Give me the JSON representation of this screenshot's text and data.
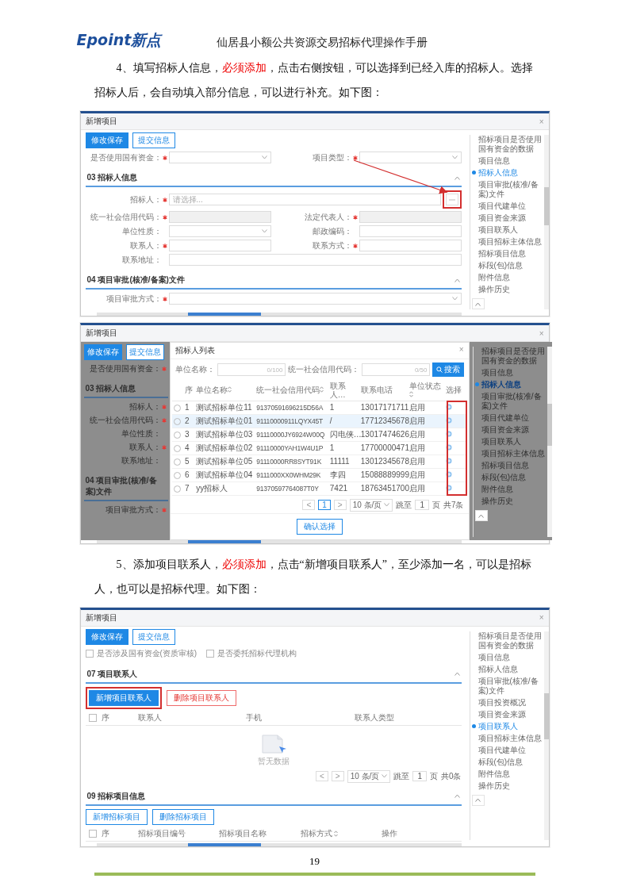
{
  "header": {
    "logo": "Epoint新点",
    "title": "仙居县小额公共资源交易招标代理操作手册"
  },
  "blocks": [
    {
      "kind": "paragraph",
      "segments": [
        {
          "text": "4、填写招标人信息，",
          "emphasis": false
        },
        {
          "text": "必须添加",
          "emphasis": true
        },
        {
          "text": "，点击右侧按钮，可以选择到已经入库的招标人。选择招标人后，会自动填入部分信息，可以进行补充。如下图：",
          "emphasis": false
        }
      ]
    },
    {
      "kind": "screen",
      "window_title": "新增项目",
      "close": "×",
      "masked": false,
      "toolbar": [
        {
          "label": "修改保存",
          "primary": true
        },
        {
          "label": "提交信息",
          "primary": false
        }
      ],
      "main": [
        {
          "kind": "fields",
          "fields": [
            {
              "label": "是否使用国有资金：",
              "required": true,
              "kind": "select"
            },
            {
              "label": "项目类型：",
              "required": true,
              "kind": "select"
            }
          ]
        },
        {
          "kind": "section",
          "title": "03 招标人信息"
        },
        {
          "kind": "fields",
          "fields": [
            {
              "label": "招标人：",
              "required": true,
              "kind": "lookup",
              "placeholder": "请选择...",
              "annotated": true
            }
          ]
        },
        {
          "kind": "fields",
          "fields": [
            {
              "label": "统一社会信用代码：",
              "required": true,
              "kind": "readonly"
            },
            {
              "label": "法定代表人：",
              "required": true,
              "kind": "readonly"
            }
          ]
        },
        {
          "kind": "fields",
          "fields": [
            {
              "label": "单位性质：",
              "required": false,
              "kind": "select"
            },
            {
              "label": "邮政编码：",
              "required": false,
              "kind": "input"
            }
          ]
        },
        {
          "kind": "fields",
          "fields": [
            {
              "label": "联系人：",
              "required": true,
              "kind": "input"
            },
            {
              "label": "联系方式：",
              "required": true,
              "kind": "input"
            }
          ]
        },
        {
          "kind": "fields",
          "fields": [
            {
              "label": "联系地址：",
              "required": false,
              "kind": "input"
            }
          ]
        },
        {
          "kind": "section",
          "title": "04 项目审批(核准/备案)文件"
        },
        {
          "kind": "fields",
          "fields": [
            {
              "label": "项目审批方式：",
              "required": true,
              "kind": "select"
            }
          ]
        }
      ],
      "nav": [
        {
          "label": "招标项目是否使用国有资金的数据",
          "selected": false
        },
        {
          "label": "项目信息",
          "selected": false
        },
        {
          "label": "招标人信息",
          "selected": true
        },
        {
          "label": "项目审批(核准/备案)文件",
          "selected": false
        },
        {
          "label": "项目代建单位",
          "selected": false
        },
        {
          "label": "项目资金来源",
          "selected": false
        },
        {
          "label": "项目联系人",
          "selected": false
        },
        {
          "label": "项目招标主体信息",
          "selected": false
        },
        {
          "label": "招标项目信息",
          "selected": false
        },
        {
          "label": "标段(包)信息",
          "selected": false
        },
        {
          "label": "附件信息",
          "selected": false
        },
        {
          "label": "操作历史",
          "selected": false
        }
      ]
    },
    {
      "kind": "screen",
      "window_title": "新增项目",
      "close": "×",
      "masked": true,
      "toolbar": [
        {
          "label": "修改保存",
          "primary": true
        },
        {
          "label": "提交信息",
          "primary": false
        }
      ],
      "main": [
        {
          "kind": "fields",
          "fields": [
            {
              "label": "是否使用国有资金：",
              "required": true,
              "kind": "hidden"
            }
          ]
        },
        {
          "kind": "section",
          "title": "03 招标人信息"
        },
        {
          "kind": "fields",
          "fields": [
            {
              "label": "招标人：",
              "required": true,
              "kind": "hidden"
            }
          ]
        },
        {
          "kind": "fields",
          "fields": [
            {
              "label": "统一社会信用代码：",
              "required": true,
              "kind": "hidden"
            }
          ]
        },
        {
          "kind": "fields",
          "fields": [
            {
              "label": "单位性质：",
              "required": false,
              "kind": "hidden"
            }
          ]
        },
        {
          "kind": "fields",
          "fields": [
            {
              "label": "联系人：",
              "required": true,
              "kind": "hidden"
            }
          ]
        },
        {
          "kind": "fields",
          "fields": [
            {
              "label": "联系地址：",
              "required": false,
              "kind": "hidden"
            }
          ]
        },
        {
          "kind": "section",
          "title": "04 项目审批(核准/备案)文件"
        },
        {
          "kind": "fields",
          "fields": [
            {
              "label": "项目审批方式：",
              "required": true,
              "kind": "hidden"
            }
          ]
        }
      ],
      "dialog": {
        "title": "招标人列表",
        "close": "×",
        "search": [
          {
            "label": "单位名称：",
            "counter": "0/100"
          },
          {
            "label": "统一社会信用代码：",
            "counter": "0/50"
          }
        ],
        "search_button": "搜索",
        "columns": [
          {
            "label": "序",
            "sortable": false,
            "annotated": false
          },
          {
            "label": "单位名称",
            "sortable": true,
            "annotated": false
          },
          {
            "label": "统一社会信用代码",
            "sortable": true,
            "annotated": false
          },
          {
            "label": "联系人…",
            "sortable": false,
            "annotated": false
          },
          {
            "label": "联系电话",
            "sortable": false,
            "annotated": false
          },
          {
            "label": "单位状态",
            "sortable": true,
            "annotated": false
          },
          {
            "label": "选择",
            "sortable": false,
            "annotated": true
          }
        ],
        "rows": [
          {
            "selected": false,
            "cells": [
              "1",
              "测试招标单位11",
              "91370591696215D56A",
              "1",
              "13017171711",
              "启用"
            ]
          },
          {
            "selected": true,
            "cells": [
              "2",
              "测试招标单位01",
              "91110000911LQYX45T",
              "/",
              "17712345678",
              "启用"
            ]
          },
          {
            "selected": false,
            "cells": [
              "3",
              "测试招标单位03",
              "91110000JY6924W00Q",
              "闪电侠…",
              "13017474626",
              "启用"
            ]
          },
          {
            "selected": false,
            "cells": [
              "4",
              "测试招标单位02",
              "91110000YAH1W4U1P",
              "1",
              "17700000471",
              "启用"
            ]
          },
          {
            "selected": false,
            "cells": [
              "5",
              "测试招标单位05",
              "91110000RR8SYT91K",
              "11111",
              "13012345678",
              "启用"
            ]
          },
          {
            "selected": false,
            "cells": [
              "6",
              "测试招标单位04",
              "9111000XX0WHM29K",
              "李四",
              "15088889999",
              "启用"
            ]
          },
          {
            "selected": false,
            "cells": [
              "7",
              "yy招标人",
              "91370597764087T0Y",
              "7421",
              "18763451700",
              "启用"
            ]
          }
        ],
        "pagination": {
          "prev": "<",
          "pages": [
            {
              "label": "1",
              "selected": true
            }
          ],
          "next": ">",
          "size": "10 条/页",
          "jump_label": "跳至",
          "jump_value": "1",
          "page_unit": "页",
          "total": "共7条"
        },
        "confirm": "确认选择"
      },
      "nav": [
        {
          "label": "招标项目是否使用国有资金的数据",
          "selected": false
        },
        {
          "label": "项目信息",
          "selected": false
        },
        {
          "label": "招标人信息",
          "selected": true
        },
        {
          "label": "项目审批(核准/备案)文件",
          "selected": false
        },
        {
          "label": "项目代建单位",
          "selected": false
        },
        {
          "label": "项目资金来源",
          "selected": false
        },
        {
          "label": "项目联系人",
          "selected": false
        },
        {
          "label": "项目招标主体信息",
          "selected": false
        },
        {
          "label": "招标项目信息",
          "selected": false
        },
        {
          "label": "标段(包)信息",
          "selected": false
        },
        {
          "label": "附件信息",
          "selected": false
        },
        {
          "label": "操作历史",
          "selected": false
        }
      ]
    },
    {
      "kind": "paragraph",
      "segments": [
        {
          "text": "5、添加项目联系人，",
          "emphasis": false
        },
        {
          "text": "必须添加",
          "emphasis": true
        },
        {
          "text": "，点击“新增项目联系人”，至少添加一名，可以是招标人，也可以是招标代理。如下图：",
          "emphasis": false
        }
      ]
    },
    {
      "kind": "screen",
      "window_title": "新增项目",
      "close": "×",
      "masked": false,
      "toolbar": [
        {
          "label": "修改保存",
          "primary": true
        },
        {
          "label": "提交信息",
          "primary": false
        }
      ],
      "main": [
        {
          "kind": "checks",
          "items": [
            {
              "label": "是否涉及国有资金(资质审核)",
              "checked": false
            },
            {
              "label": "是否委托招标代理机构",
              "checked": false
            }
          ]
        },
        {
          "kind": "section",
          "title": "07 项目联系人"
        },
        {
          "kind": "buttons",
          "items": [
            {
              "label": "新增项目联系人",
              "kind": "primary",
              "annotated": true
            },
            {
              "label": "删除项目联系人",
              "kind": "danger",
              "annotated": false
            }
          ]
        },
        {
          "kind": "table_header",
          "checked": false,
          "columns": [
            {
              "label": "序",
              "sortable": false
            },
            {
              "label": "联系人",
              "sortable": false
            },
            {
              "label": "手机",
              "sortable": false
            },
            {
              "label": "联系人类型",
              "sortable": false
            }
          ]
        },
        {
          "kind": "empty",
          "text": "暂无数据"
        },
        {
          "kind": "pagination",
          "prev": "<",
          "next": ">",
          "size": "10 条/页",
          "jump_label": "跳至",
          "jump_value": "1",
          "page_unit": "页",
          "total": "共0条"
        },
        {
          "kind": "section",
          "title": "09 招标项目信息"
        },
        {
          "kind": "buttons",
          "items": [
            {
              "label": "新增招标项目",
              "kind": "outline",
              "annotated": false
            },
            {
              "label": "删除招标项目",
              "kind": "outline",
              "annotated": false
            }
          ]
        },
        {
          "kind": "table_header",
          "checked": false,
          "columns": [
            {
              "label": "序",
              "sortable": false
            },
            {
              "label": "招标项目编号",
              "sortable": false
            },
            {
              "label": "招标项目名称",
              "sortable": false
            },
            {
              "label": "招标方式",
              "sortable": true
            },
            {
              "label": "操作",
              "sortable": false
            }
          ]
        }
      ],
      "nav": [
        {
          "label": "招标项目是否使用国有资金的数据",
          "selected": false
        },
        {
          "label": "项目信息",
          "selected": false
        },
        {
          "label": "招标人信息",
          "selected": false
        },
        {
          "label": "项目审批(核准/备案)文件",
          "selected": false
        },
        {
          "label": "项目投资概况",
          "selected": false
        },
        {
          "label": "项目资金来源",
          "selected": false
        },
        {
          "label": "项目联系人",
          "selected": true
        },
        {
          "label": "项目招标主体信息",
          "selected": false
        },
        {
          "label": "项目代建单位",
          "selected": false
        },
        {
          "label": "标段(包)信息",
          "selected": false
        },
        {
          "label": "附件信息",
          "selected": false
        },
        {
          "label": "操作历史",
          "selected": false
        }
      ]
    }
  ],
  "page_number": "19"
}
